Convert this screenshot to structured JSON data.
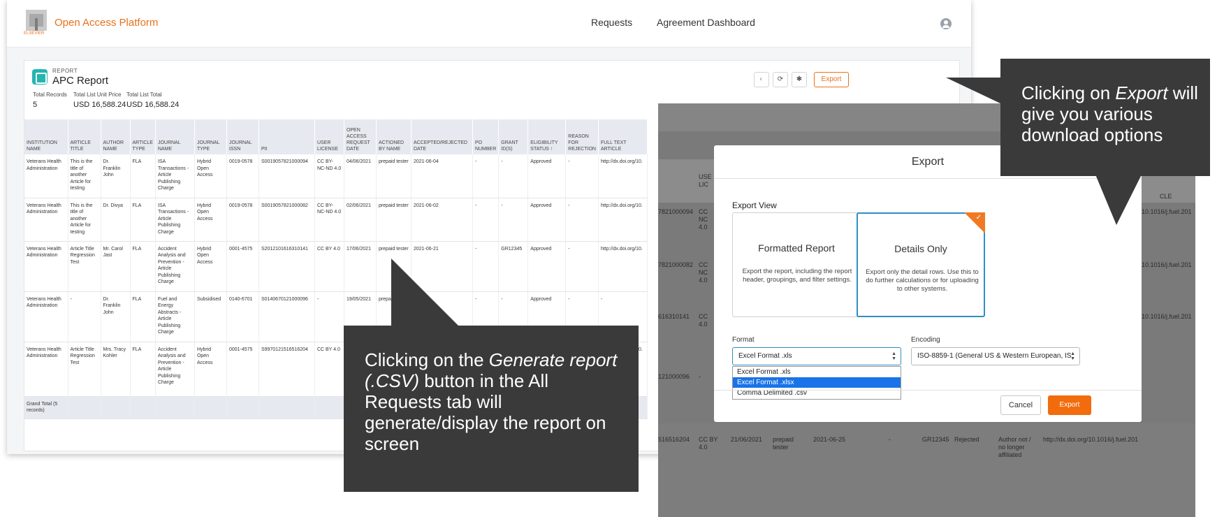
{
  "app": {
    "brand": "Open Access Platform",
    "logo_text": "ELSEVIER",
    "nav": {
      "requests": "Requests",
      "agreement_dashboard": "Agreement Dashboard"
    }
  },
  "report": {
    "subtitle": "REPORT",
    "title": "APC Report",
    "export_label": "Export",
    "summary": [
      {
        "label": "Total Records",
        "value": "5"
      },
      {
        "label": "Total List Unit Price",
        "value": "USD 16,588.24"
      },
      {
        "label": "Total List Total",
        "value": "USD 16,588.24"
      }
    ],
    "columns": [
      "INSTITUTION NAME",
      "ARTICLE TITLE",
      "AUTHOR NAME",
      "ARTICLE TYPE",
      "JOURNAL NAME",
      "JOURNAL TYPE",
      "JOURNAL ISSN",
      "PII",
      "USER LICENSE",
      "OPEN ACCESS REQUEST DATE",
      "ACTIONED BY NAME",
      "ACCEPTED/REJECTED DATE",
      "PO NUMBER",
      "GRANT ID(S)",
      "ELIGIBILITY STATUS ↑",
      "REASON FOR REJECTION",
      "FULL TEXT ARTICLE"
    ],
    "rows": [
      [
        "Veterans Health Administration",
        "This is the title of another Article for testing",
        "Dr. Franklin John",
        "FLA",
        "ISA Transactions - Article Publishing Charge",
        "Hybrid Open Access",
        "0019-0578",
        "S0019057821000094",
        "CC BY-NC-ND 4.0",
        "04/06/2021",
        "prepaid tester",
        "2021-06-04",
        "-",
        "-",
        "Approved",
        "-",
        "http://dx.doi.org/10."
      ],
      [
        "Veterans Health Administration",
        "This is the title of another Article for testing",
        "Dr. Divya",
        "FLA",
        "ISA Transactions - Article Publishing Charge",
        "Hybrid Open Access",
        "0019-0578",
        "S0019057821000082",
        "CC BY-NC-ND 4.0",
        "02/06/2021",
        "prepaid tester",
        "2021-06-02",
        "-",
        "-",
        "Approved",
        "-",
        "http://dx.doi.org/10."
      ],
      [
        "Veterans Health Administration",
        "Article Title Regression Test",
        "Mr. Carol Jast",
        "FLA",
        "Accident Analysis and Prevention - Article Publishing Charge",
        "Hybrid Open Access",
        "0001-4575",
        "S2012101616310141",
        "CC BY 4.0",
        "17/06/2021",
        "prepaid tester",
        "2021-06-21",
        "-",
        "GR12345",
        "Approved",
        "-",
        "http://dx.doi.org/10."
      ],
      [
        "Veterans Health Administration",
        "-",
        "Dr. Franklin John",
        "FLA",
        "Fuel and Energy Abstracts - Article Publishing Charge",
        "Subsidised",
        "0140-6701",
        "S0140670121000096",
        "-",
        "19/05/2021",
        "prepaid tester",
        "",
        "-",
        "-",
        "Approved",
        "-",
        "-"
      ],
      [
        "Veterans Health Administration",
        "Article Title Regression Test",
        "Mrs. Tracy Kohler",
        "FLA",
        "Accident Analysis and Prevention - Article Publishing Charge",
        "Hybrid Open Access",
        "0001-4575",
        "S9970121516516204",
        "CC BY 4.0",
        "",
        "",
        "",
        "",
        "",
        "",
        "",
        "http://dx.doi.org/10."
      ]
    ],
    "grand_total": "Grand Total (5 records)"
  },
  "export_dialog": {
    "title": "Export",
    "export_view_label": "Export View",
    "formatted_title": "Formatted Report",
    "formatted_desc": "Export the report, including the report header, groupings, and filter settings.",
    "details_title": "Details Only",
    "details_desc": "Export only the detail rows. Use this to do further calculations or for uploading to other systems.",
    "format_label": "Format",
    "format_value": "Excel Format .xls",
    "format_options": [
      "Excel Format .xls",
      "Excel Format .xlsx",
      "Comma Delimited .csv"
    ],
    "format_highlighted": "Excel Format .xlsx",
    "encoding_label": "Encoding",
    "encoding_value": "ISO-8859-1 (General US & Western European, IS",
    "cancel_label": "Cancel",
    "export_label": "Export"
  },
  "background_fragments": {
    "col_user": "USE",
    "col_lic": "LIC",
    "col_cle": "CLE",
    "row1_id": "7821000094",
    "row1_lic": "CC NC 4.0",
    "row1_url": "10.1016/j.fuel.201",
    "row2_id": "7821000082",
    "row2_lic": "CC NC 4.0",
    "row2_url": "10.1016/j.fuel.201",
    "row3_id": "616310141",
    "row3_lic": "CC 4.0",
    "row3_url": "10.1016/j.fuel.201",
    "row4_id": "121000096",
    "row4_lic": "-",
    "row5_id": "516516204",
    "row5_lic": "CC BY 4.0",
    "row5_date": "21/06/2021",
    "row5_actioned": "prepaid tester",
    "row5_accepted": "2021-06-25",
    "row5_po": "-",
    "row5_grant": "GR12345",
    "row5_status": "Rejected",
    "row5_reason": "Author not / no longer affiliated",
    "row5_url": "http://dx.doi.org/10.1016/j.fuel.201"
  },
  "callouts": {
    "export": {
      "pre": "Clicking on ",
      "em": "Export",
      "post": " will give you various download options"
    },
    "generate": {
      "pre": "Clicking on the ",
      "em": "Generate report (.CSV)",
      "post": " button in the All Requests tab will generate/display the report on screen"
    }
  },
  "colors": {
    "accent": "#e9711c",
    "export_button": "#f26c0d",
    "callout_bg": "#3a3a3a",
    "selected_border": "#2d8ec7",
    "report_icon": "#23b5b0"
  }
}
